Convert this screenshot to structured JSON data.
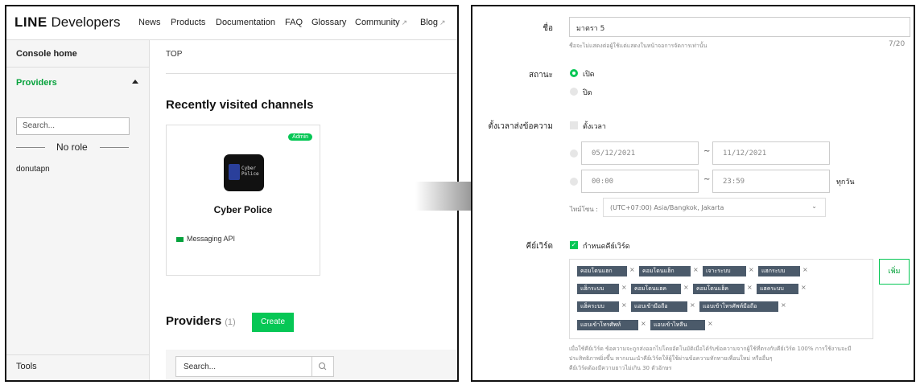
{
  "left": {
    "brand": {
      "line": "LINE",
      "developers": "Developers"
    },
    "nav": {
      "news": "News",
      "products": "Products",
      "documentation": "Documentation",
      "faq": "FAQ",
      "glossary": "Glossary",
      "community": "Community",
      "blog": "Blog"
    },
    "sidebar": {
      "console_home": "Console home",
      "providers": "Providers",
      "search_placeholder": "Search...",
      "no_role": "No role",
      "user": "donutapn",
      "tools": "Tools"
    },
    "main": {
      "breadcrumb": "TOP",
      "recent_title": "Recently visited channels",
      "card": {
        "badge": "Admin",
        "icon_text_1": "Cyber",
        "icon_text_2": "Police",
        "title": "Cyber Police",
        "type": "Messaging API"
      },
      "providers_title": "Providers",
      "providers_count": "(1)",
      "create_label": "Create",
      "search_placeholder": "Search..."
    }
  },
  "right": {
    "name": {
      "label": "ชื่อ",
      "value": "มาตรา 5",
      "hint": "ชื่อจะไม่แสดงต่อผู้ใช้แต่แสดงในหน้าจอการจัดการเท่านั้น",
      "counter": "7/20"
    },
    "status": {
      "label": "สถานะ",
      "on": "เปิด",
      "off": "ปิด"
    },
    "schedule": {
      "label": "ตั้งเวลาส่งข้อความ",
      "checkbox": "ตั้งเวลา",
      "date_start": "05/12/2021",
      "date_end": "11/12/2021",
      "time_start": "00:00",
      "time_end": "23:59",
      "repeat": "ทุกวัน",
      "tz_label": "ไทม์โซน :",
      "tz_value": "(UTC+07:00) Asia/Bangkok, Jakarta",
      "tilde": "~"
    },
    "keywords": {
      "label": "คีย์เวิร์ด",
      "checkbox": "กำหนดคีย์เวิร์ด",
      "add_label": "เพิ่ม",
      "tags": [
        "คอมโดนแฮก",
        "คอมโดนแฮ็ก",
        "เจาะระบบ",
        "แฮกระบบ",
        "แฮ็กระบบ",
        "คอมโดนแฮค",
        "คอมโดนแฮ็ค",
        "แฮคระบบ",
        "แฮ็คระบบ",
        "แอบเข้ามือถือ",
        "แอบเข้าโทรศัพท์มือถือ",
        "แอบเข้าโทรศัพท์",
        "แอบเข้าไทลีน"
      ],
      "note_1": "เมื่อใช้คีย์เวิร์ด ข้อความจะถูกส่งออกไปโดยอัตโนมัติเมื่อได้รับข้อความจากผู้ใช้ที่ตรงกับคีย์เวิร์ด 100% การใช้งานจะมี",
      "note_2": "ประสิทธิภาพยิ่งขึ้น หากแนะนำคีย์เวิร์ดให้ผู้ใช้ผ่านข้อความทักทายเพื่อนใหม่ หรืออื่นๆ",
      "note_3": "คีย์เวิร์ดต้องมีความยาวไม่เกิน 30 ตัวอักษร"
    }
  },
  "colors": {
    "line_green": "#06c755",
    "tag_bg": "#4b5a6a"
  },
  "icons": [
    "external-link-icon",
    "caret-up-icon",
    "search-icon",
    "chevron-down-icon",
    "checkmark-icon",
    "tag-remove-icon",
    "arrow-icon"
  ]
}
